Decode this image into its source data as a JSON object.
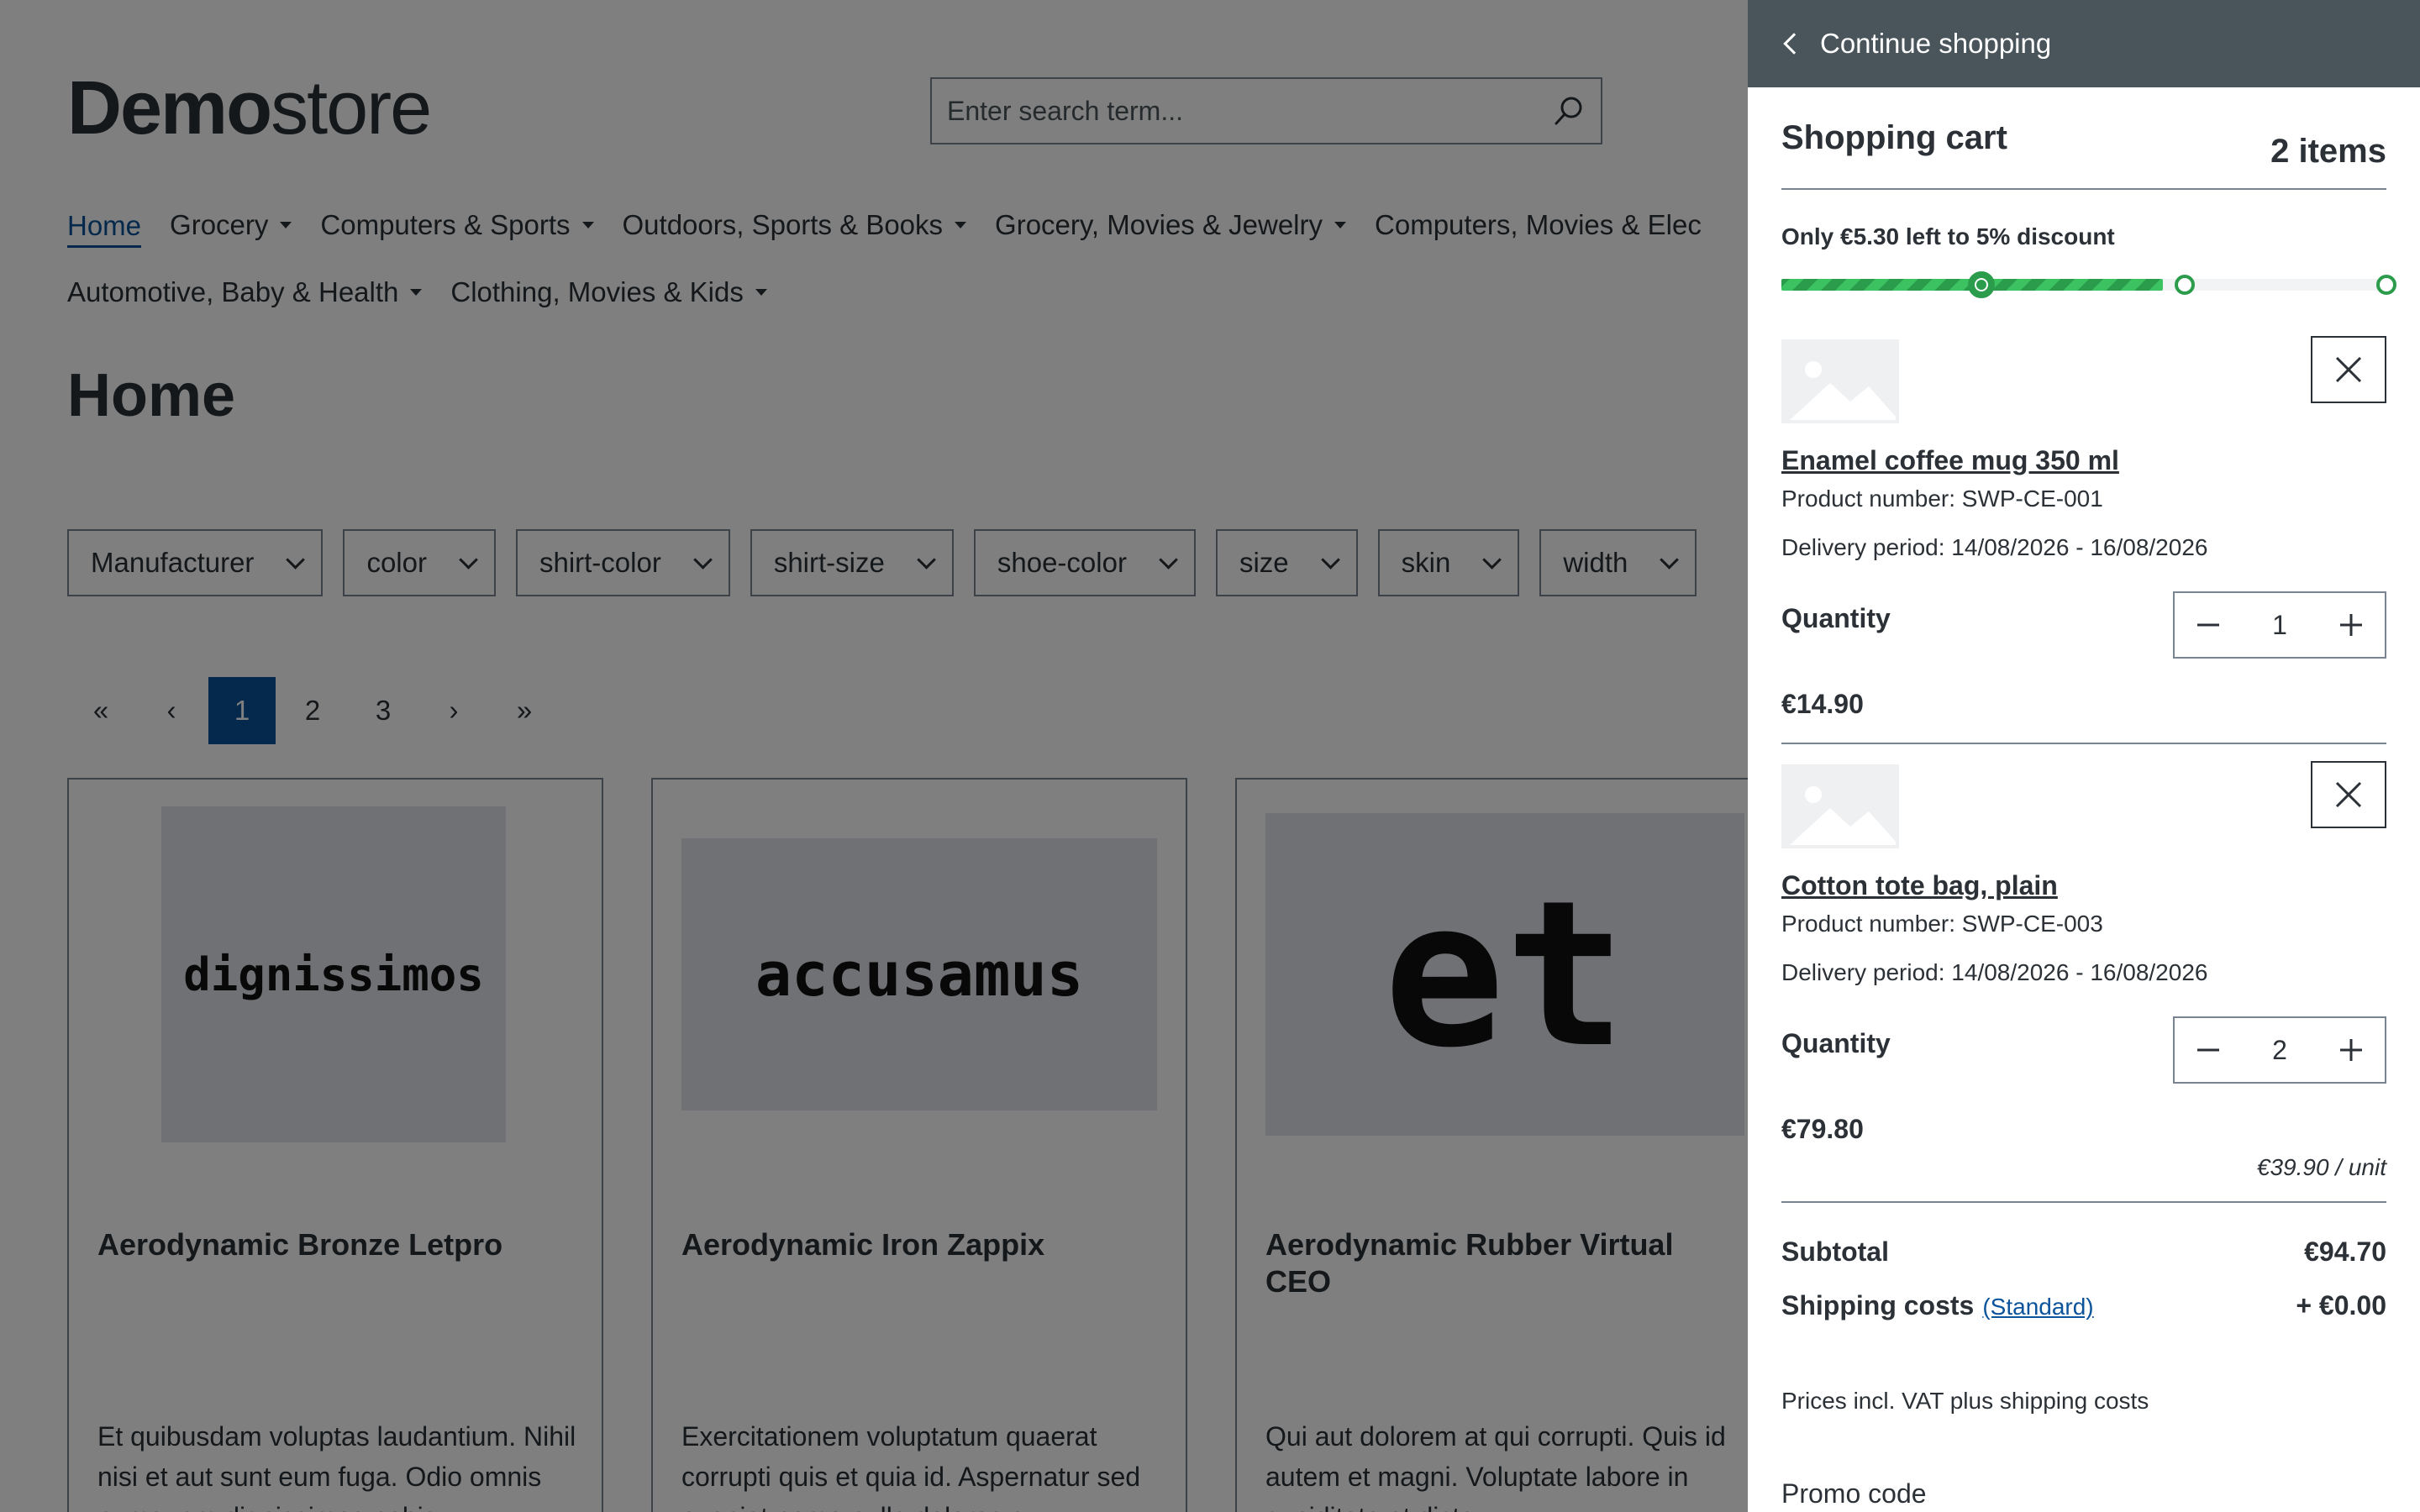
{
  "store": {
    "logo_bold": "Demo",
    "logo_light": "store",
    "search_placeholder": "Enter search term...",
    "nav_row1": [
      "Home",
      "Grocery",
      "Computers & Sports",
      "Outdoors, Sports & Books",
      "Grocery, Movies & Jewelry",
      "Computers, Movies & Elec"
    ],
    "nav_row2": [
      "Automotive, Baby & Health",
      "Clothing, Movies & Kids"
    ],
    "page_title": "Home",
    "filters": [
      "Manufacturer",
      "color",
      "shirt-color",
      "shirt-size",
      "shoe-color",
      "size",
      "skin",
      "width"
    ],
    "pagination": {
      "first": "«",
      "prev": "‹",
      "pages": [
        "1",
        "2",
        "3"
      ],
      "next": "›",
      "last": "»",
      "current": "1"
    },
    "products": [
      {
        "image_text": "dignissimos",
        "name": "Aerodynamic Bronze Letpro",
        "description": "Et quibusdam voluptas laudantium. Nihil nisi et aut sunt eum fuga. Odio omnis numquam dignissimos nobis"
      },
      {
        "image_text": "accusamus",
        "name": "Aerodynamic Iron Zappix",
        "description": "Exercitationem voluptatum quaerat corrupti quis et quia id. Aspernatur sed eveniet nemo nulla dolores a"
      },
      {
        "image_text": "et",
        "name": "Aerodynamic Rubber Virtual CEO",
        "description": "Qui aut dolorem at qui corrupti. Quis id autem et magni. Voluptate labore in cupiditate et dicta"
      }
    ]
  },
  "cart": {
    "back_label": "Continue shopping",
    "title": "Shopping cart",
    "count": "2 items",
    "discount_message": "Only €5.30 left to 5% discount",
    "progress_fraction": 0.63,
    "items": [
      {
        "name": "Enamel coffee mug 350 ml",
        "product_number": "Product number: SWP-CE-001",
        "delivery": "Delivery period: 14/08/2026 - 16/08/2026",
        "quantity_label": "Quantity",
        "quantity": "1",
        "price": "€14.90",
        "unit_price": ""
      },
      {
        "name": "Cotton tote bag, plain",
        "product_number": "Product number: SWP-CE-003",
        "delivery": "Delivery period: 14/08/2026 - 16/08/2026",
        "quantity_label": "Quantity",
        "quantity": "2",
        "price": "€79.80",
        "unit_price": "€39.90 / unit"
      }
    ],
    "subtotal_label": "Subtotal",
    "subtotal_value": "€94.70",
    "shipping_label": "Shipping costs",
    "shipping_method": "(Standard)",
    "shipping_value": "+ €0.00",
    "vat_note": "Prices incl. VAT plus shipping costs",
    "promo_label": "Promo code"
  },
  "colors": {
    "brand_blue": "#0b539b",
    "progress_green": "#2b9c4c",
    "header_grey": "#4a545b"
  }
}
